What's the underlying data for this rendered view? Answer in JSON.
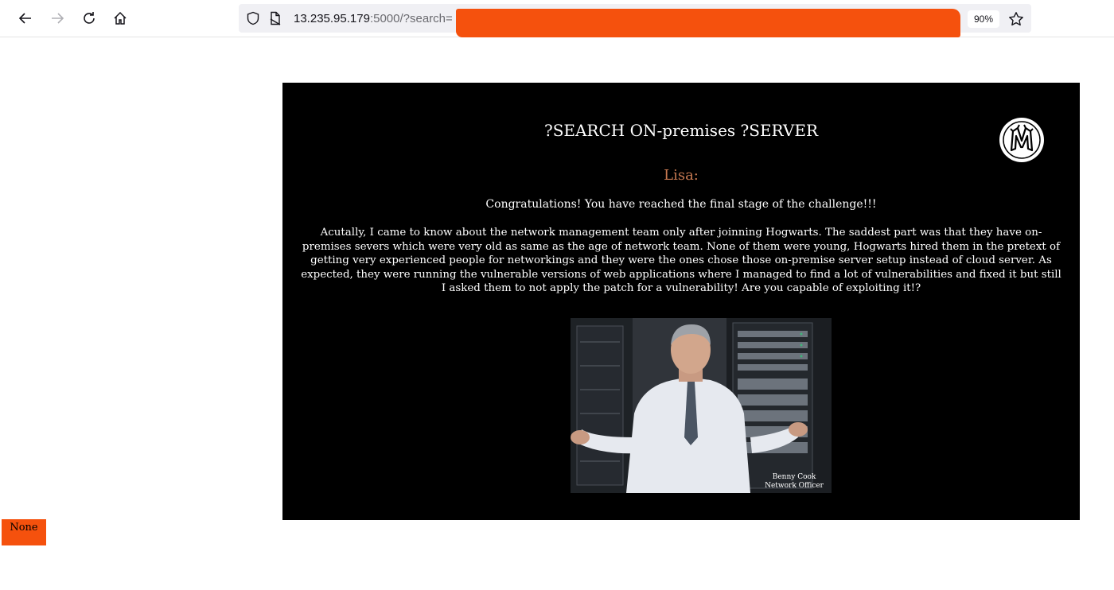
{
  "browser": {
    "url_host": "13.235.95.179",
    "url_rest": ":5000/?search=",
    "zoom": "90%",
    "icons": {
      "back": "arrow-left-icon",
      "forward": "arrow-right-icon",
      "reload": "reload-icon",
      "home": "home-icon",
      "shield": "shield-icon",
      "page": "page-icon",
      "bookmark": "star-icon"
    }
  },
  "page": {
    "title": "?SEARCH ON-premises ?SERVER",
    "speaker": "Lisa:",
    "congrats": "Congratulations! You have reached the final stage of the challenge!!!",
    "story": "Acutally, I came to know about the network management team only after joinning Hogwarts. The saddest part was that they have on-premises severs which were very old as same as the age of network team. None of them were young, Hogwarts hired them in the pretext of getting very experienced people for networkings and they were the ones chose those on-premise server setup instead of cloud server. As expected, they were running the vulnerable versions of web applications where I managed to find a lot of vulnerabilities and fixed it but still I asked them to not apply the patch for a vulnerability! Are you capable of exploiting it!?",
    "gif_caption_name": "Benny Cook",
    "gif_caption_role": "Network Officer",
    "result": "None",
    "colors": {
      "panel_bg": "#000000",
      "speaker": "#c87a52",
      "redaction": "#f5510d"
    }
  }
}
